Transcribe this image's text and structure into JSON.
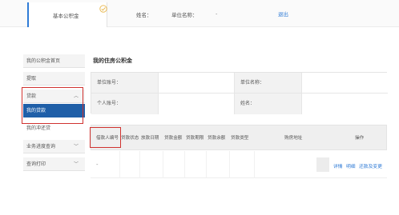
{
  "topbar": {
    "system_tab": "基本公积金",
    "name_label": "姓名：",
    "unit_label": "单位名称：",
    "unit_value": "-",
    "logout": "退出"
  },
  "sidebar": {
    "items": [
      {
        "label": "我的公积金首页"
      },
      {
        "label": "提取"
      },
      {
        "label": "贷款",
        "expanded": true
      },
      {
        "label": "我的贷款",
        "active": true
      },
      {
        "label": "我的冲还贷"
      },
      {
        "label": "业务进度查询"
      },
      {
        "label": "查询打印"
      }
    ]
  },
  "main": {
    "title": "我的住房公积金",
    "info": {
      "unit_account_label": "单位账号：",
      "unit_name_label": "单位名称：",
      "personal_account_label": "个人账号：",
      "name_label": "姓名："
    },
    "loan_table": {
      "columns": [
        "借款人编号",
        "贷款状态",
        "放款日期",
        "贷款金额",
        "贷款期限",
        "贷款余额",
        "贷款类型",
        "购房地址",
        "操作"
      ],
      "row": {
        "borrower_id": "-",
        "actions": [
          "详情",
          "明细",
          "还款及变更"
        ]
      }
    }
  },
  "colors": {
    "accent": "#1f5fa8",
    "link": "#2f7bd6",
    "highlight_box": "#d0322f"
  }
}
